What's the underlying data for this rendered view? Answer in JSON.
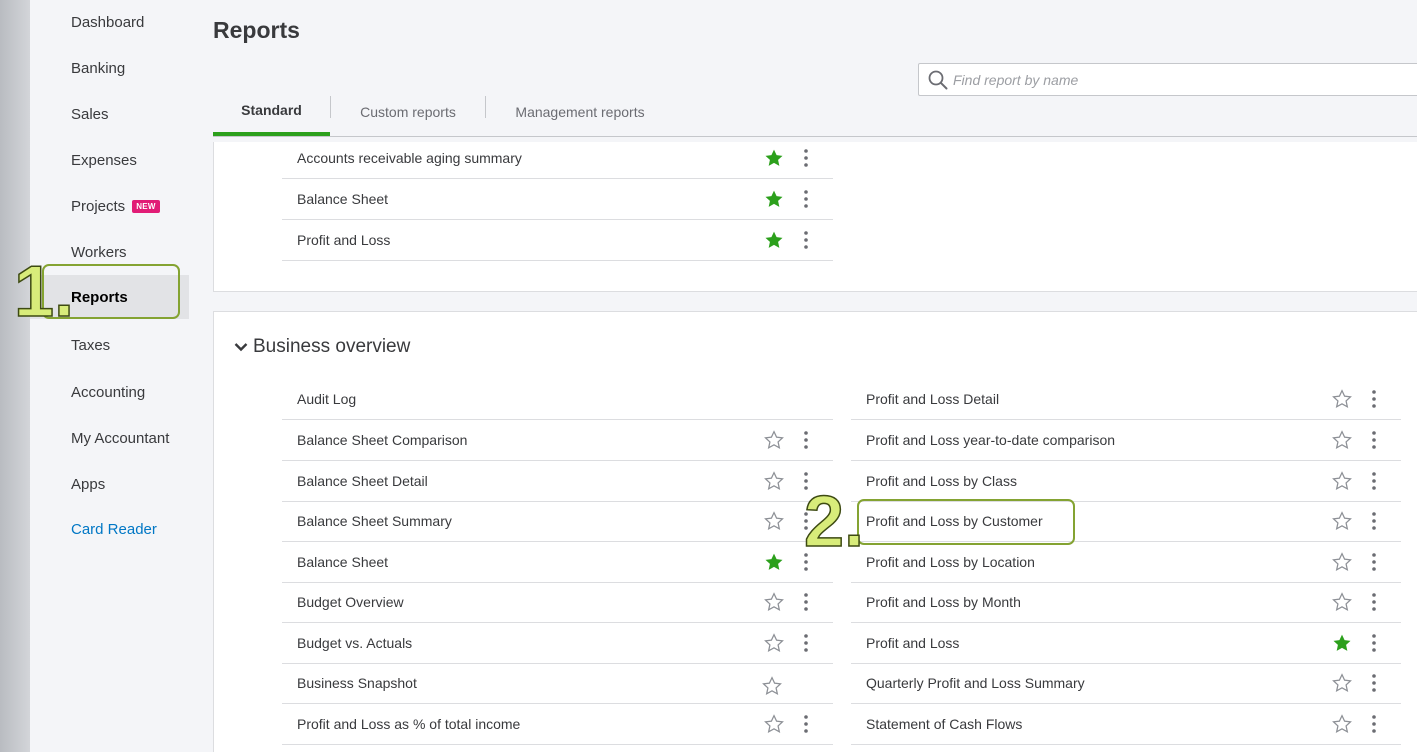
{
  "sidebar": {
    "items": [
      {
        "label": "Dashboard"
      },
      {
        "label": "Banking"
      },
      {
        "label": "Sales"
      },
      {
        "label": "Expenses"
      },
      {
        "label": "Projects",
        "badge": "NEW"
      },
      {
        "label": "Workers"
      },
      {
        "label": "Reports",
        "active": true
      },
      {
        "label": "Taxes"
      },
      {
        "label": "Accounting"
      },
      {
        "label": "My Accountant"
      },
      {
        "label": "Apps"
      },
      {
        "label": "Card Reader"
      }
    ]
  },
  "header": {
    "title": "Reports"
  },
  "search": {
    "placeholder": "Find report by name"
  },
  "tabs": [
    {
      "label": "Standard",
      "active": true
    },
    {
      "label": "Custom reports"
    },
    {
      "label": "Management reports"
    }
  ],
  "favourites": {
    "rows": [
      {
        "name": "Accounts receivable aging summary",
        "starred": true
      },
      {
        "name": "Balance Sheet",
        "starred": true
      },
      {
        "name": "Profit and Loss",
        "starred": true
      }
    ]
  },
  "business_overview": {
    "title": "Business overview",
    "left": [
      {
        "name": "Audit Log",
        "starred": false,
        "no_actions": true
      },
      {
        "name": "Balance Sheet Comparison",
        "starred": false
      },
      {
        "name": "Balance Sheet Detail",
        "starred": false
      },
      {
        "name": "Balance Sheet Summary",
        "starred": false
      },
      {
        "name": "Balance Sheet",
        "starred": true
      },
      {
        "name": "Budget Overview",
        "starred": false
      },
      {
        "name": "Budget vs. Actuals",
        "starred": false
      },
      {
        "name": "Business Snapshot",
        "starred": false,
        "no_kebab": true
      },
      {
        "name": "Profit and Loss as % of total income",
        "starred": false
      }
    ],
    "right": [
      {
        "name": "Profit and Loss Detail",
        "starred": false
      },
      {
        "name": "Profit and Loss year-to-date comparison",
        "starred": false
      },
      {
        "name": "Profit and Loss by Class",
        "starred": false
      },
      {
        "name": "Profit and Loss by Customer",
        "starred": false
      },
      {
        "name": "Profit and Loss by Location",
        "starred": false
      },
      {
        "name": "Profit and Loss by Month",
        "starred": false
      },
      {
        "name": "Profit and Loss",
        "starred": true
      },
      {
        "name": "Quarterly Profit and Loss Summary",
        "starred": false
      },
      {
        "name": "Statement of Cash Flows",
        "starred": false
      }
    ]
  },
  "annotations": {
    "step1": "1.",
    "step2": "2."
  },
  "colors": {
    "accent": "#2ca01c",
    "link": "#0077c5",
    "badge": "#e11c76",
    "annotation": "#d8ec7a"
  }
}
